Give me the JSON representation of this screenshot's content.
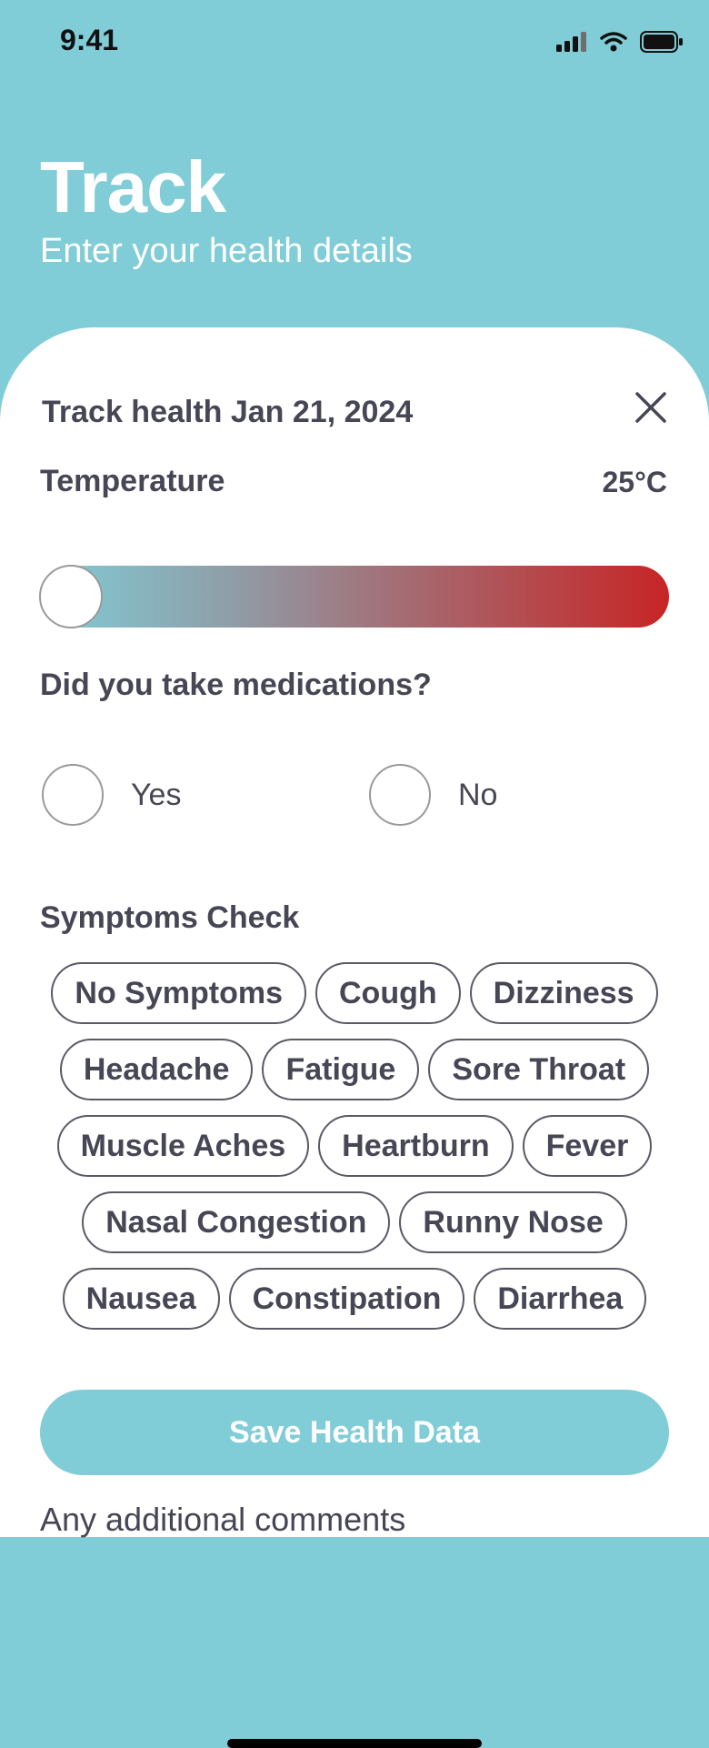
{
  "status_bar": {
    "time": "9:41"
  },
  "header": {
    "title": "Track",
    "subtitle": "Enter your health details"
  },
  "sheet": {
    "title": "Track health Jan 21, 2024",
    "temperature": {
      "label": "Temperature",
      "value": "25°C",
      "level": 0
    },
    "medications": {
      "question": "Did you take medications?",
      "options": [
        "Yes",
        "No"
      ]
    },
    "symptoms": {
      "label": "Symptoms Check",
      "rows": [
        [
          "No Symptoms",
          "Cough",
          "Dizziness"
        ],
        [
          "Headache",
          "Fatigue",
          "Sore Throat"
        ],
        [
          "Muscle Aches",
          "Heartburn",
          "Fever"
        ],
        [
          "Nasal Congestion",
          "Runny Nose"
        ],
        [
          "Nausea",
          "Constipation",
          "Diarrhea"
        ]
      ]
    },
    "save_label": "Save Health Data",
    "comments_placeholder": "Any additional comments"
  },
  "colors": {
    "accent": "#80CDD7",
    "hot": "#C72525",
    "text": "#464655"
  },
  "icons": [
    "signal-icon",
    "wifi-icon",
    "battery-icon",
    "close-icon"
  ]
}
